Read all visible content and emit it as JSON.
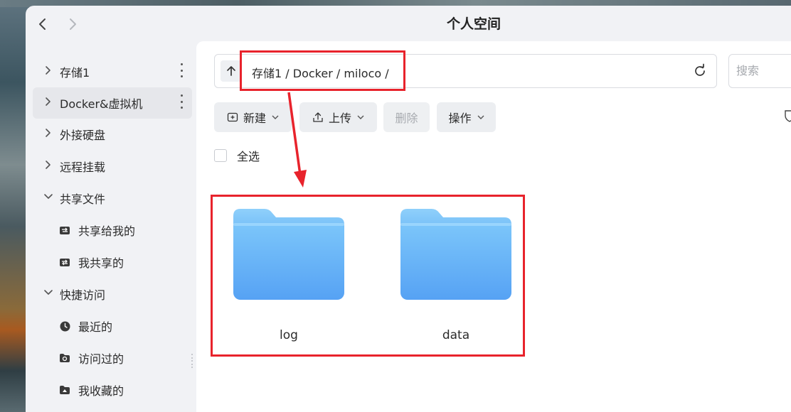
{
  "window": {
    "title": "个人空间",
    "back_icon": "chevron-left-icon",
    "forward_icon": "chevron-right-icon"
  },
  "sidebar": {
    "items": [
      {
        "label": "存储1",
        "icon": "chevron-right-icon",
        "has_menu": true
      },
      {
        "label": "Docker&虚拟机",
        "icon": "chevron-right-icon",
        "has_menu": true,
        "active": true
      },
      {
        "label": "外接硬盘",
        "icon": "chevron-right-icon"
      },
      {
        "label": "远程挂载",
        "icon": "chevron-right-icon"
      },
      {
        "label": "共享文件",
        "icon": "chevron-down-icon"
      },
      {
        "label": "共享给我的",
        "icon": "share-in-icon"
      },
      {
        "label": "我共享的",
        "icon": "share-out-icon"
      },
      {
        "label": "快捷访问",
        "icon": "chevron-down-icon"
      },
      {
        "label": "最近的",
        "icon": "clock-icon"
      },
      {
        "label": "访问过的",
        "icon": "visited-folder-icon"
      },
      {
        "label": "我收藏的",
        "icon": "favorite-folder-icon"
      }
    ]
  },
  "pathbar": {
    "up_icon": "arrow-up-icon",
    "path": "存储1 / Docker / miloco /",
    "refresh_icon": "refresh-icon"
  },
  "search": {
    "placeholder": "搜索"
  },
  "toolbar": {
    "new_label": "新建",
    "upload_label": "上传",
    "delete_label": "删除",
    "actions_label": "操作"
  },
  "select_all_label": "全选",
  "folders": [
    {
      "name": "log",
      "icon": "folder-icon"
    },
    {
      "name": "data",
      "icon": "folder-icon"
    }
  ],
  "colors": {
    "annotation": "#e8232c",
    "folder_light": "#8fd0fb",
    "folder_dark": "#5aa3f5"
  }
}
